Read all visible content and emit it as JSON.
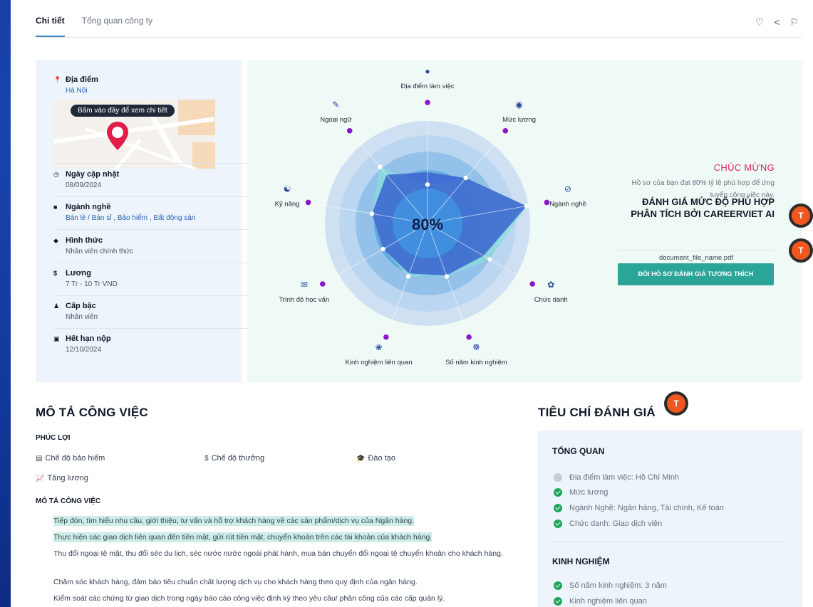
{
  "tabs": [
    {
      "label": "Chi tiết",
      "active": true
    },
    {
      "label": "Tổng quan công ty",
      "active": false
    }
  ],
  "top_actions": {
    "favorite_icon": "heart-icon",
    "share_icon": "share-icon",
    "report_icon": "flag-icon"
  },
  "info": {
    "location": {
      "label": "Địa điểm",
      "value": "Hà Nội"
    },
    "map_tooltip": "Bấm vào đây để xem chi tiết",
    "updated": {
      "label": "Ngày cập nhật",
      "value": "08/09/2024"
    },
    "industry": {
      "label": "Ngành nghề",
      "value": "Bán lẻ / Bán sỉ , Bảo hiểm , Bất động sản"
    },
    "form": {
      "label": "Hình thức",
      "value": "Nhân viên chính thức"
    },
    "salary": {
      "label": "Lương",
      "value": "7 Tr - 10 Tr VND"
    },
    "level": {
      "label": "Cấp bậc",
      "value": "Nhân viên"
    },
    "deadline": {
      "label": "Hết hạn nộp",
      "value": "12/10/2024"
    }
  },
  "radar": {
    "center_text": "80%",
    "axes": [
      "Địa điểm làm việc",
      "Mức lương",
      "Ngành nghề",
      "Chức danh",
      "Số năm kinh nghiệm",
      "Kinh nghiệm liên quan",
      "Trình độ học vấn",
      "Kỹ năng",
      "Ngoại ngữ"
    ],
    "job_values": [
      0.38,
      0.58,
      0.98,
      0.7,
      0.55,
      0.55,
      0.5,
      0.55,
      0.72
    ],
    "candidate_values": [
      0.5,
      0.58,
      0.98,
      0.63,
      0.54,
      0.52,
      0.5,
      0.55,
      0.62
    ],
    "colors": {
      "outer": "#cfe0f3",
      "rings": [
        "#b7d3ef",
        "#8cbde8",
        "#5aa6e0",
        "#2f8ad4"
      ],
      "job_fill": "#8adcd9",
      "candidate_fill": "#3a64cf",
      "axis_dot": "#8b17c9"
    }
  },
  "congrats": {
    "title": "CHÚC MỪNG",
    "message": "Hồ sơ của bạn đạt 80% tỷ lệ phù hợp để ứng tuyển công việc này.",
    "ai_title_line1": "ĐÁNH GIÁ MỨC ĐỘ PHÙ HỢP",
    "ai_title_line2": "PHÂN TÍCH BỞI CAREERVIET AI",
    "file_name": "document_file_name.pdf",
    "cta": "ĐỔI HỒ SƠ ĐÁNH GIÁ TƯƠNG THÍCH"
  },
  "avatar_letter": "T",
  "job": {
    "section_title": "MÔ TẢ CÔNG VIỆC",
    "benefits_title": "PHÚC LỢI",
    "benefits": [
      "Chế độ bảo hiểm",
      "Chế độ thưởng",
      "Đào tạo",
      "Tăng lương"
    ],
    "desc_title": "MÔ TẢ CÔNG VIỆC",
    "desc": [
      "Tiếp đón, tìm hiểu nhu cầu, giới thiệu, tư vấn và hỗ trợ khách hàng về các sản phẩm/dịch vụ của Ngân hàng.",
      "Thực hiện các giao dịch liên quan đến tiền mặt, gửi rút tiền mặt, chuyển khoản trên các tài khoản của khách hàng.",
      "Thu đổi ngoại tệ mặt, thu đổi séc du lịch, séc nước nước ngoài phát hành, mua bán chuyển đổi ngoại tệ chuyển khoản cho khách hàng.",
      "Chăm sóc khách hàng, đảm bảo tiêu chuẩn chất lượng dịch vụ cho khách hàng theo quy định của ngân hàng.",
      "Kiểm soát các chứng từ giao dịch trong ngày báo cáo công việc định kỳ theo yêu cầu/ phân công của các cấp quản lý."
    ]
  },
  "criteria": {
    "title": "TIÊU CHÍ ĐÁNH GIÁ",
    "overview_title": "TỔNG QUAN",
    "overview": [
      {
        "text": "Địa điểm làm việc: Hồ Chí Minh",
        "ok": false
      },
      {
        "text": "Mức lương",
        "ok": true
      },
      {
        "text": "Ngành Nghề: Ngân hàng, Tài chính, Kế toán",
        "ok": true
      },
      {
        "text": "Chức danh: Giao dịch viên",
        "ok": true
      }
    ],
    "experience_title": "KINH NGHIỆM",
    "experience": [
      {
        "text": "Số năm kinh nghiệm: 3 năm",
        "ok": true
      },
      {
        "text": "Kinh nghiệm liên quan",
        "ok": true
      }
    ]
  }
}
